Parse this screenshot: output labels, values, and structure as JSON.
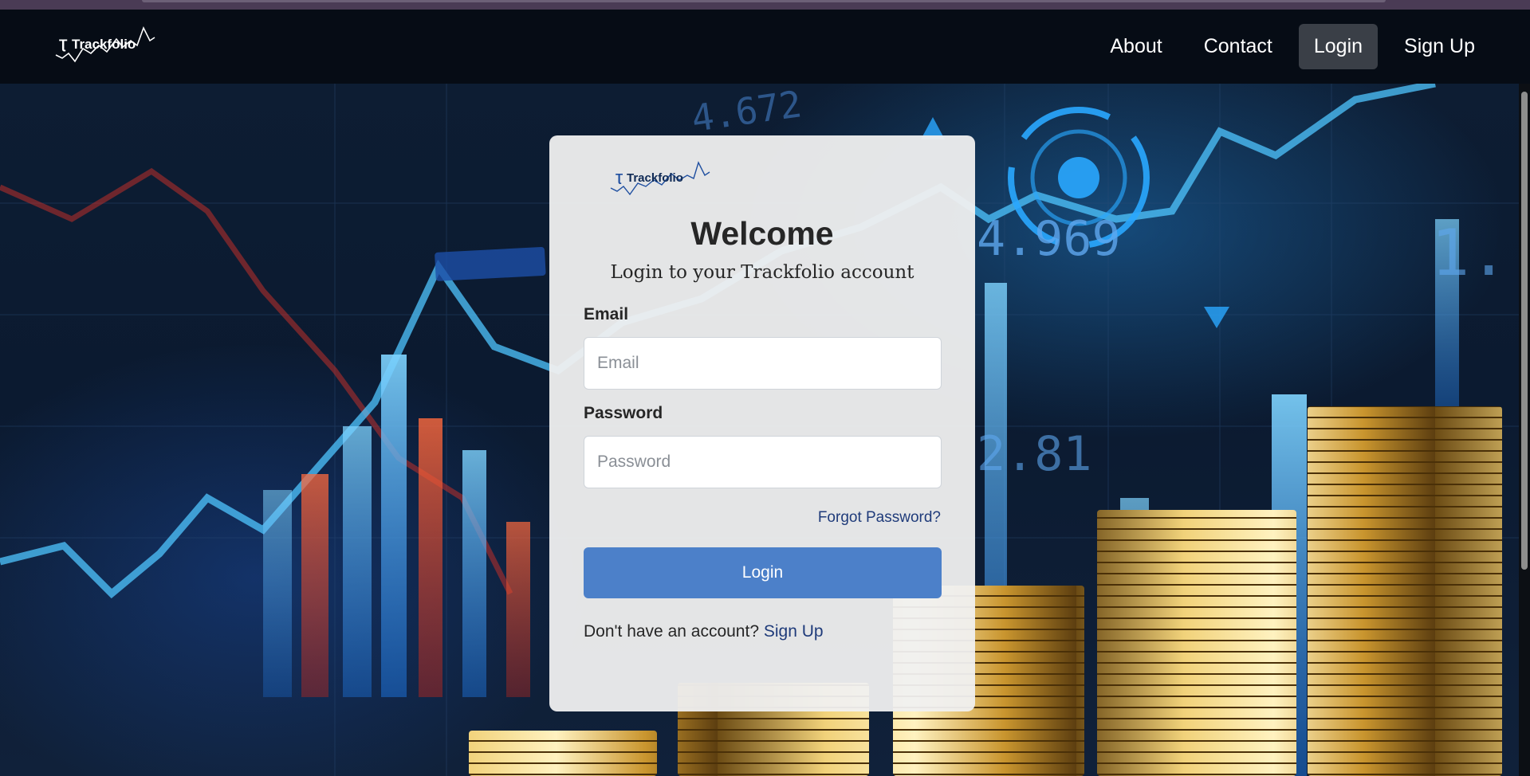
{
  "navbar": {
    "brand_text": "Trackfolio",
    "links": [
      {
        "label": "About",
        "active": false
      },
      {
        "label": "Contact",
        "active": false
      },
      {
        "label": "Login",
        "active": true
      },
      {
        "label": "Sign Up",
        "active": false
      }
    ]
  },
  "card": {
    "logo_text": "Trackfolio",
    "title": "Welcome",
    "subtitle": "Login to your Trackfolio account",
    "email": {
      "label": "Email",
      "placeholder": "Email",
      "value": ""
    },
    "password": {
      "label": "Password",
      "placeholder": "Password",
      "value": ""
    },
    "forgot_link": "Forgot Password?",
    "login_button": "Login",
    "signup_prompt": "Don't have an account?",
    "signup_link": "Sign Up"
  },
  "background": {
    "ticker_numbers": [
      "4.672",
      "4.969",
      "2.81",
      "1."
    ],
    "colors": {
      "accent": "#4c80c9",
      "navbar": "#060c15",
      "chart_blue": "#2aa8ff",
      "chart_red": "#e8433a",
      "coin_gold": "#d4a73a"
    }
  }
}
